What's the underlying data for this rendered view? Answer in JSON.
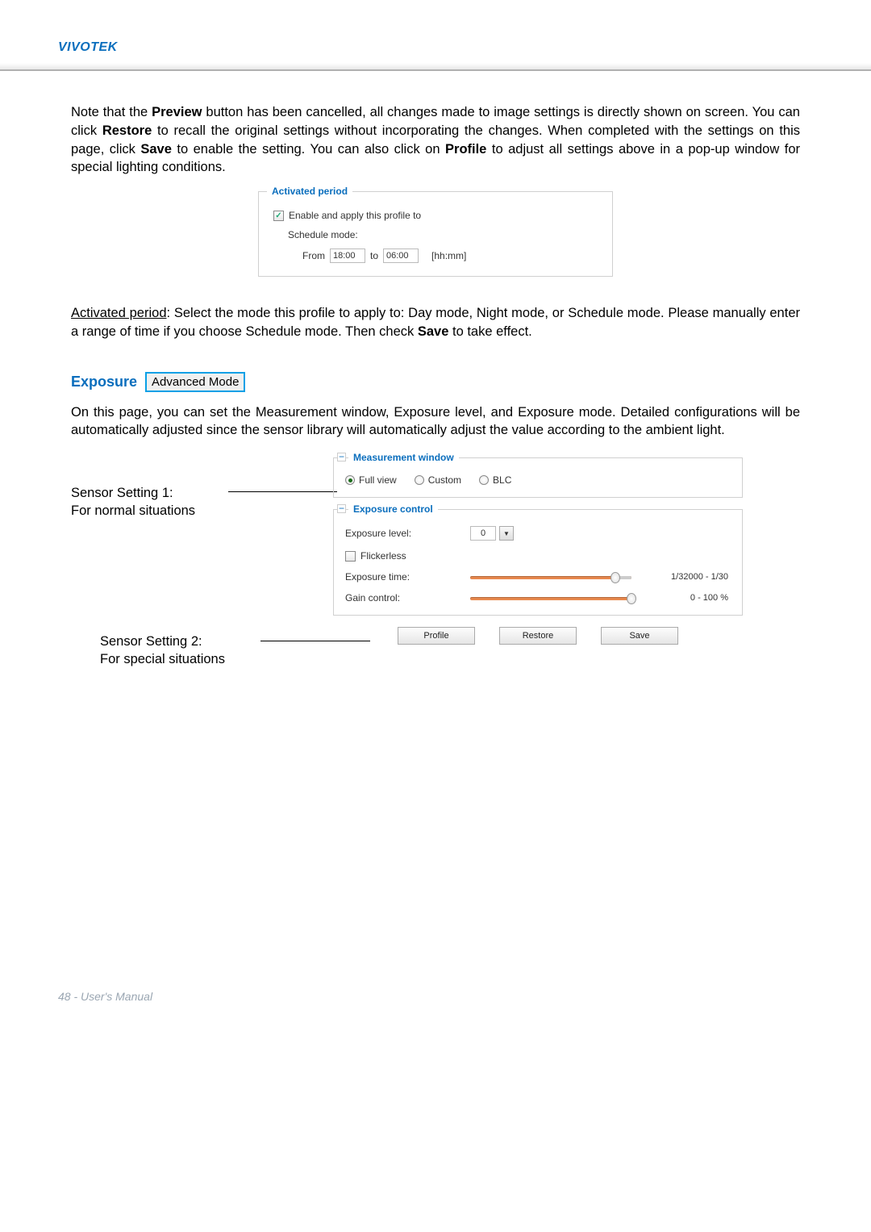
{
  "header": {
    "title": "VIVOTEK"
  },
  "intro": {
    "p1_a": "Note that the ",
    "p1_preview": "Preview",
    "p1_b": " button has been cancelled, all changes made to image settings is directly shown on screen. You can click ",
    "p1_restore": "Restore",
    "p1_c": " to recall the original settings without incorporating the changes. When completed with the settings on this page, click ",
    "p1_save": "Save",
    "p1_d": " to enable the setting. You can also click on ",
    "p1_profile": "Profile",
    "p1_e": " to adjust all settings above in a pop-up window for special lighting conditions."
  },
  "activated": {
    "legend": "Activated period",
    "enable_label": "Enable and apply this profile to",
    "enable_checked": true,
    "schedule_label": "Schedule mode:",
    "from_label": "From",
    "from_value": "18:00",
    "to_label": "to",
    "to_value": "06:00",
    "format_hint": "[hh:mm]"
  },
  "activatedPara": {
    "lead": "Activated period",
    "rest": ": Select the mode this profile to apply to: Day mode, Night mode, or Schedule mode. Please manually enter a range of time if you choose Schedule mode. Then check ",
    "save": "Save",
    "tail": " to take effect."
  },
  "exposureHeading": {
    "title": "Exposure",
    "badge": "Advanced Mode"
  },
  "exposurePara": "On this page, you can set the Measurement window, Exposure level, and Exposure mode. Detailed configurations will be automatically adjusted since the sensor library will automatically adjust the value according to the ambient light.",
  "sensor1": {
    "l1": "Sensor Setting 1:",
    "l2": "For normal situations"
  },
  "sensor2": {
    "l1": "Sensor Setting 2:",
    "l2": "For special situations"
  },
  "measurement": {
    "legend": "Measurement window",
    "options": {
      "full": "Full view",
      "custom": "Custom",
      "blc": "BLC"
    },
    "selected": "full"
  },
  "exposureControl": {
    "legend": "Exposure control",
    "level_label": "Exposure level:",
    "level_value": "0",
    "flickerless_label": "Flickerless",
    "time_label": "Exposure time:",
    "time_range": "1/32000 - 1/30",
    "time_pct": 90,
    "gain_label": "Gain control:",
    "gain_range": "0 - 100 %",
    "gain_pct": 100
  },
  "buttons": {
    "profile": "Profile",
    "restore": "Restore",
    "save": "Save"
  },
  "footer": {
    "text": "48 - User's Manual"
  },
  "chart_data": {
    "type": "table",
    "title": "Exposure control sliders",
    "columns": [
      "control",
      "range_text",
      "position_percent"
    ],
    "rows": [
      [
        "Exposure time",
        "1/32000 - 1/30",
        90
      ],
      [
        "Gain control",
        "0 - 100 %",
        100
      ]
    ]
  }
}
